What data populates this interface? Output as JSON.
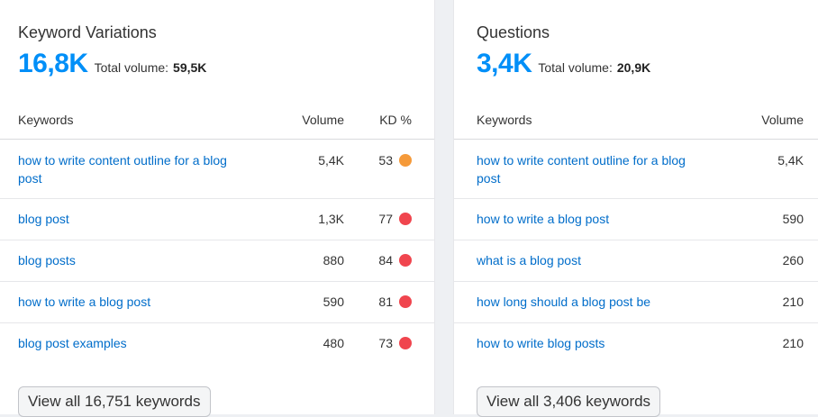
{
  "left_panel": {
    "title": "Keyword Variations",
    "count": "16,8K",
    "total_volume_label": "Total volume:",
    "total_volume_value": "59,5K",
    "columns": {
      "keywords": "Keywords",
      "volume": "Volume",
      "kd": "KD %"
    },
    "rows": [
      {
        "keyword_line1": "how to write content outline for a blog",
        "keyword_line2": "post",
        "volume": "5,4K",
        "kd": "53",
        "kd_color": "#f59a3a"
      },
      {
        "keyword_line1": "blog post",
        "keyword_line2": "",
        "volume": "1,3K",
        "kd": "77",
        "kd_color": "#f0454e"
      },
      {
        "keyword_line1": "blog posts",
        "keyword_line2": "",
        "volume": "880",
        "kd": "84",
        "kd_color": "#f0454e"
      },
      {
        "keyword_line1": "how to write a blog post",
        "keyword_line2": "",
        "volume": "590",
        "kd": "81",
        "kd_color": "#f0454e"
      },
      {
        "keyword_line1": "blog post examples",
        "keyword_line2": "",
        "volume": "480",
        "kd": "73",
        "kd_color": "#f0454e"
      }
    ],
    "view_all_label": "View all 16,751 keywords"
  },
  "right_panel": {
    "title": "Questions",
    "count": "3,4K",
    "total_volume_label": "Total volume:",
    "total_volume_value": "20,9K",
    "columns": {
      "keywords": "Keywords",
      "volume": "Volume"
    },
    "rows": [
      {
        "keyword_line1": "how to write content outline for a blog",
        "keyword_line2": "post",
        "volume": "5,4K"
      },
      {
        "keyword_line1": "how to write a blog post",
        "keyword_line2": "",
        "volume": "590"
      },
      {
        "keyword_line1": "what is a blog post",
        "keyword_line2": "",
        "volume": "260"
      },
      {
        "keyword_line1": "how long should a blog post be",
        "keyword_line2": "",
        "volume": "210"
      },
      {
        "keyword_line1": "how to write blog posts",
        "keyword_line2": "",
        "volume": "210"
      }
    ],
    "view_all_label": "View all 3,406 keywords"
  },
  "colors": {
    "accent": "#008ff8",
    "link": "#006dca",
    "kd_orange": "#f59a3a",
    "kd_red": "#f0454e"
  }
}
